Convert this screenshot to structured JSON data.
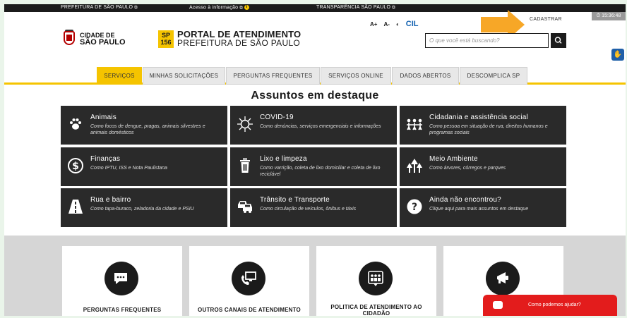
{
  "govbar": {
    "link1": "PREFEITURA DE SÃO PAULO",
    "link2": "Acesso à informação",
    "link3": "TRANSPARÊNCIA SÃO PAULO"
  },
  "clock": "15:36:48",
  "header": {
    "city_line1": "CIDADE DE",
    "city_line2": "SÃO PAULO",
    "badge_top": "SP",
    "badge_bottom": "156",
    "portal_title": "PORTAL DE ATENDIMENTO",
    "portal_subtitle": "PREFEITURA DE SÃO PAULO",
    "acc_plus": "A+",
    "acc_minus": "A-",
    "acc_contrast": "◐",
    "cil": "CIL",
    "cadastrar": "CADASTRAR",
    "search_placeholder": "O que você está buscando?"
  },
  "nav": {
    "tabs": [
      {
        "label": "SERVIÇOS"
      },
      {
        "label": "MINHAS SOLICITAÇÕES"
      },
      {
        "label": "PERGUNTAS FREQUENTES"
      },
      {
        "label": "SERVIÇOS ONLINE"
      },
      {
        "label": "DADOS ABERTOS"
      },
      {
        "label": "DESCOMPLICA SP"
      }
    ]
  },
  "section_title": "Assuntos em destaque",
  "cards": [
    {
      "title": "Animais",
      "desc": "Como focos de dengue, pragas, animais silvestres e animais domésticos",
      "icon": "paw-icon"
    },
    {
      "title": "COVID-19",
      "desc": "Como denúncias, serviços emergenciais e informações",
      "icon": "virus-icon"
    },
    {
      "title": "Cidadania e assistência social",
      "desc": "Como pessoa em situação de rua, direitos humanos e programas sociais",
      "icon": "people-icon"
    },
    {
      "title": "Finanças",
      "desc": "Como IPTU, ISS e Nota Paulistana",
      "icon": "dollar-icon"
    },
    {
      "title": "Lixo e limpeza",
      "desc": "Como varrição, coleta de lixo domiciliar e coleta de lixo reciclável",
      "icon": "trash-icon"
    },
    {
      "title": "Meio Ambiente",
      "desc": "Como árvores, córregos e parques",
      "icon": "tree-icon"
    },
    {
      "title": "Rua e bairro",
      "desc": "Como tapa-buraco, zeladoria da cidade e PSIU",
      "icon": "road-icon"
    },
    {
      "title": "Trânsito e Transporte",
      "desc": "Como circulação de veículos, ônibus e táxis",
      "icon": "car-icon"
    },
    {
      "title": "Ainda não encontrou?",
      "desc": "Clique aqui para mais assuntos em destaque",
      "icon": "question-icon"
    }
  ],
  "bottom_cards": [
    {
      "label": "PERGUNTAS FREQUENTES",
      "icon": "chat-icon"
    },
    {
      "label": "OUTROS CANAIS DE ATENDIMENTO",
      "icon": "phone-monitor-icon"
    },
    {
      "label": "POLITICA DE ATENDIMENTO AO CIDADÃO",
      "icon": "group-icon"
    },
    {
      "label": "OUVIDORIA",
      "icon": "megaphone-icon"
    }
  ],
  "chat": {
    "label": "Como podemos ajudar?"
  },
  "colors": {
    "accent": "#f5c400",
    "dark": "#2a2a2a",
    "chat": "#e31c1c",
    "arrow": "#f7a21b"
  }
}
